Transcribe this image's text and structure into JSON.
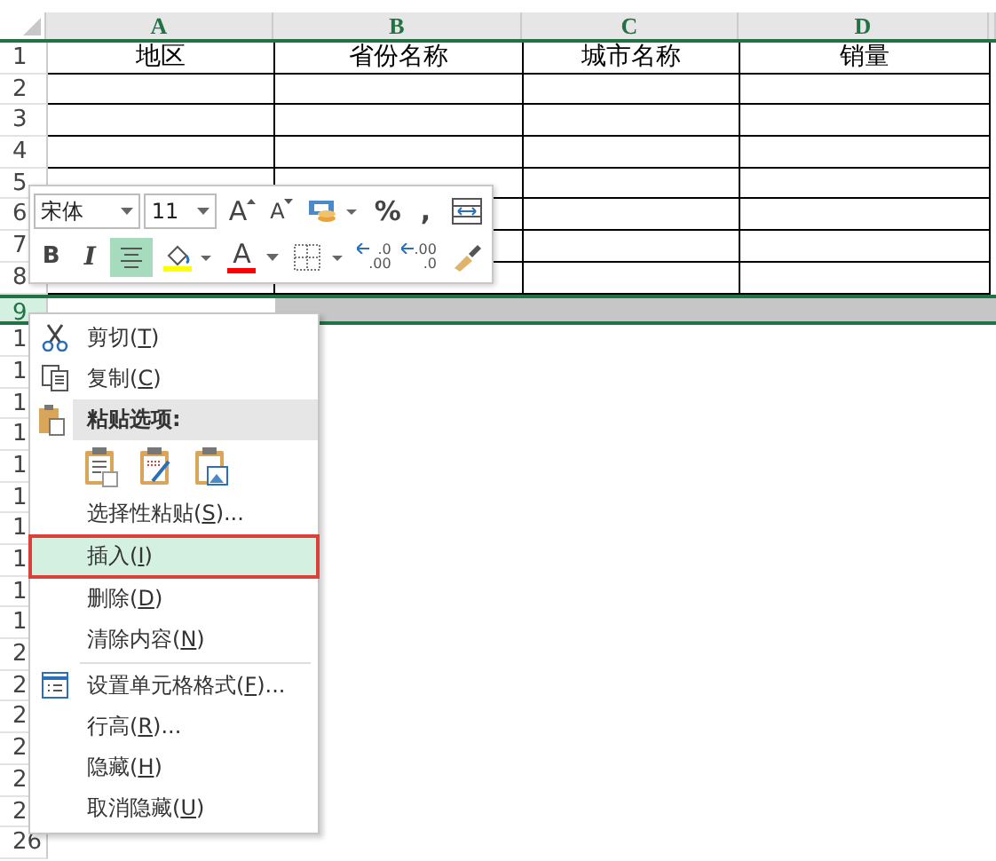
{
  "sheet": {
    "columns": [
      {
        "letter": "A"
      },
      {
        "letter": "B"
      },
      {
        "letter": "C"
      },
      {
        "letter": "D"
      }
    ],
    "rows": [
      {
        "label": "1",
        "selected": false,
        "bordered": true,
        "cells": [
          "地区",
          "省份名称",
          "城市名称",
          "销量"
        ]
      },
      {
        "label": "2",
        "selected": false,
        "bordered": true
      },
      {
        "label": "3",
        "selected": false,
        "bordered": true
      },
      {
        "label": "4",
        "selected": false,
        "bordered": true
      },
      {
        "label": "5",
        "selected": false,
        "bordered": true
      },
      {
        "label": "6",
        "selected": false,
        "bordered": true
      },
      {
        "label": "7",
        "selected": false,
        "bordered": true
      },
      {
        "label": "8",
        "selected": false,
        "bordered": true
      },
      {
        "label": "9",
        "selected": true,
        "bordered": false
      },
      {
        "label": "1",
        "selected": false,
        "bordered": false
      },
      {
        "label": "1",
        "selected": false,
        "bordered": false
      },
      {
        "label": "1",
        "selected": false,
        "bordered": false
      },
      {
        "label": "1",
        "selected": false,
        "bordered": false
      },
      {
        "label": "1",
        "selected": false,
        "bordered": false
      },
      {
        "label": "1",
        "selected": false,
        "bordered": false
      },
      {
        "label": "1",
        "selected": false,
        "bordered": false
      },
      {
        "label": "1",
        "selected": false,
        "bordered": false
      },
      {
        "label": "1",
        "selected": false,
        "bordered": false
      },
      {
        "label": "1",
        "selected": false,
        "bordered": false
      },
      {
        "label": "2",
        "selected": false,
        "bordered": false
      },
      {
        "label": "2",
        "selected": false,
        "bordered": false
      },
      {
        "label": "2",
        "selected": false,
        "bordered": false
      },
      {
        "label": "2",
        "selected": false,
        "bordered": false
      },
      {
        "label": "2",
        "selected": false,
        "bordered": false
      },
      {
        "label": "2",
        "selected": false,
        "bordered": false
      },
      {
        "label": "26",
        "selected": false,
        "bordered": false
      }
    ]
  },
  "mini_toolbar": {
    "font_name": "宋体",
    "font_size": "11",
    "row_1": [
      {
        "kind": "grow-font",
        "text": "A"
      },
      {
        "kind": "shrink-font",
        "text": "A"
      },
      {
        "kind": "accounting"
      },
      {
        "kind": "text",
        "text": "%"
      },
      {
        "kind": "text",
        "text": ","
      },
      {
        "kind": "merge"
      }
    ],
    "row_2": [
      {
        "kind": "bold",
        "text": "B",
        "selected": false
      },
      {
        "kind": "italic",
        "text": "I",
        "selected": false
      },
      {
        "kind": "align-center",
        "selected": true
      },
      {
        "kind": "fill-color",
        "color": "#ffff00"
      },
      {
        "kind": "font-color",
        "text": "A",
        "color": "#ff0000"
      },
      {
        "kind": "borders"
      },
      {
        "kind": "increase-decimal",
        "top": ".0",
        "bottom": ".00"
      },
      {
        "kind": "decrease-decimal",
        "top": ".00",
        "bottom": ".0"
      },
      {
        "kind": "format-painter"
      }
    ]
  },
  "context_menu": [
    {
      "kind": "cut",
      "before": "剪切(",
      "key": "T",
      "after": ")",
      "selected": false
    },
    {
      "kind": "copy",
      "before": "复制(",
      "key": "C",
      "after": ")",
      "selected": false
    },
    {
      "kind": "paste-header",
      "before": "粘贴选项:"
    },
    {
      "kind": "paste-options"
    },
    {
      "kind": "plain",
      "before": "选择性粘贴(",
      "key": "S",
      "after": ")...",
      "selected": false
    },
    {
      "kind": "plain",
      "before": "插入(",
      "key": "I",
      "after": ")",
      "selected": true
    },
    {
      "kind": "plain",
      "before": "删除(",
      "key": "D",
      "after": ")",
      "selected": false
    },
    {
      "kind": "plain",
      "before": "清除内容(",
      "key": "N",
      "after": ")",
      "selected": false
    },
    {
      "kind": "separator"
    },
    {
      "kind": "format-cells",
      "before": "设置单元格格式(",
      "key": "F",
      "after": ")...",
      "selected": false
    },
    {
      "kind": "plain",
      "before": "行高(",
      "key": "R",
      "after": ")...",
      "selected": false
    },
    {
      "kind": "plain",
      "before": "隐藏(",
      "key": "H",
      "after": ")",
      "selected": false
    },
    {
      "kind": "plain",
      "before": "取消隐藏(",
      "key": "U",
      "after": ")",
      "selected": false
    }
  ]
}
